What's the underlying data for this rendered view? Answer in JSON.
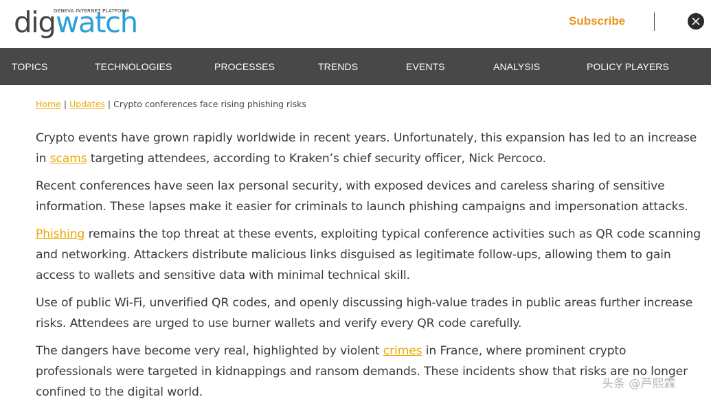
{
  "header": {
    "logo_tagline": "GENEVA INTERNET PLATFORM",
    "logo_part1": "dig",
    "logo_part2": "watch",
    "subscribe_label": "Subscribe",
    "social_icon": "x-twitter-icon",
    "colors": {
      "logo_blue": "#2d9fd8",
      "accent": "#e8941b",
      "nav_bg": "#484848"
    }
  },
  "nav": {
    "items": [
      "TOPICS",
      "TECHNOLOGIES",
      "PROCESSES",
      "TRENDS",
      "EVENTS",
      "ANALYSIS",
      "POLICY PLAYERS"
    ]
  },
  "breadcrumb": {
    "home": "Home",
    "updates": "Updates",
    "sep": "|",
    "current": "Crypto conferences face rising phishing risks"
  },
  "article": {
    "p1_a": "Crypto events have grown rapidly worldwide in recent years. Unfortunately, this expansion has led to an increase in ",
    "p1_link": "scams",
    "p1_b": " targeting attendees, according to Kraken’s chief security officer, Nick Percoco.",
    "p2": "Recent conferences have seen lax personal security, with exposed devices and careless sharing of sensitive information. These lapses make it easier for criminals to launch phishing campaigns and impersonation attacks.",
    "p3_link": "Phishing",
    "p3_b": " remains the top threat at these events, exploiting typical conference activities such as QR code scanning and networking. Attackers distribute malicious links disguised as legitimate follow-ups, allowing them to gain access to wallets and sensitive data with minimal technical skill.",
    "p4": "Use of public Wi-Fi, unverified QR codes, and openly discussing high-value trades in public areas further increase risks. Attendees are urged to use burner wallets and verify every QR code carefully.",
    "p5_a": "The dangers have become very real, highlighted by violent ",
    "p5_link": "crimes",
    "p5_b": " in France, where prominent crypto professionals were targeted in kidnappings and ransom demands. These incidents show that risks are no longer confined to the digital world."
  },
  "watermark": "头条 @芦熙霖"
}
